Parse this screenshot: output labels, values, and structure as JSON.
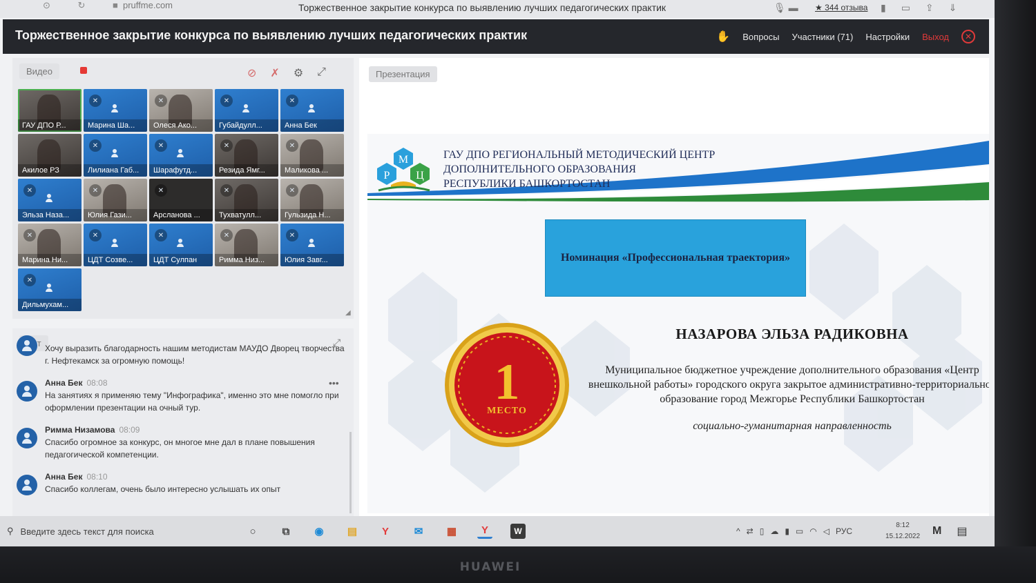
{
  "browser": {
    "url": "pruffme.com",
    "tab_title": "Торжественное закрытие конкурса по выявлению лучших педагогических практик",
    "reviews": "★ 344 отзыва"
  },
  "conference": {
    "title": "Торжественное закрытие конкурса по выявлению лучших педагогических практик",
    "nav": {
      "questions": "Вопросы",
      "participants": "Участники (71)",
      "settings": "Настройки",
      "exit": "Выход"
    }
  },
  "video": {
    "label": "Видео",
    "tiles": [
      {
        "name": "ГАУ ДПО Р...",
        "style": "cam",
        "mic_off": false
      },
      {
        "name": "Марина Ша...",
        "style": "blue",
        "mic_off": true
      },
      {
        "name": "Олеся Ако...",
        "style": "cam2",
        "mic_off": true
      },
      {
        "name": "Губайдулл...",
        "style": "blue",
        "mic_off": true
      },
      {
        "name": "Анна Бек",
        "style": "blue",
        "mic_off": true
      },
      {
        "name": "Акилое РЗ",
        "style": "cam",
        "mic_off": false
      },
      {
        "name": "Лилиана Габ...",
        "style": "blue",
        "mic_off": true
      },
      {
        "name": "Шарафутд...",
        "style": "blue",
        "mic_off": true
      },
      {
        "name": "Резида Ямг...",
        "style": "cam",
        "mic_off": true
      },
      {
        "name": "Маликова ...",
        "style": "cam2",
        "mic_off": true
      },
      {
        "name": "Эльза Наза...",
        "style": "blue",
        "mic_off": true
      },
      {
        "name": "Юлия Гази...",
        "style": "cam2",
        "mic_off": true
      },
      {
        "name": "Арсланова ...",
        "style": "dark",
        "mic_off": true
      },
      {
        "name": "Тухватулл...",
        "style": "cam",
        "mic_off": true
      },
      {
        "name": "Гульзида Н...",
        "style": "cam2",
        "mic_off": true
      },
      {
        "name": "Марина Ни...",
        "style": "cam2",
        "mic_off": true
      },
      {
        "name": "ЦДТ Созве...",
        "style": "blue",
        "mic_off": true
      },
      {
        "name": "ЦДТ Сулпан",
        "style": "blue",
        "mic_off": true
      },
      {
        "name": "Римма Низ...",
        "style": "cam2",
        "mic_off": true
      },
      {
        "name": "Юлия Завг...",
        "style": "blue",
        "mic_off": true
      },
      {
        "name": "Дильмухам...",
        "style": "blue",
        "mic_off": true
      }
    ]
  },
  "chat": {
    "label": "Чат",
    "messages": [
      {
        "author": "",
        "time": "",
        "text": "Хочу выразить благодарность нашим методистам МАУДО Дворец творчества г. Нефтекамск за огромную помощь!"
      },
      {
        "author": "Анна Бек",
        "time": "08:08",
        "text": "На занятиях я применяю тему \"Инфографика\", именно это мне помогло при оформлении презентации на очный тур."
      },
      {
        "author": "Римма Низамова",
        "time": "08:09",
        "text": "Спасибо огромное за конкурс, он многое мне дал в плане повышения педагогической компетенции."
      },
      {
        "author": "Анна Бек",
        "time": "08:10",
        "text": "Спасибо коллегам, очень было интересно услышать их опыт"
      }
    ]
  },
  "presentation": {
    "label": "Презентация",
    "org_lines": [
      "ГАУ ДПО РЕГИОНАЛЬНЫЙ МЕТОДИЧЕСКИЙ ЦЕНТР",
      "ДОПОЛНИТЕЛЬНОГО ОБРАЗОВАНИЯ",
      "РЕСПУБЛИКИ БАШКОРТОСТАН"
    ],
    "logo_letters": [
      "М",
      "Р",
      "Ц"
    ],
    "nomination": "Номинация «Профессиональная траектория»",
    "winner": "НАЗАРОВА ЭЛЬЗА РАДИКОВНА",
    "description": "Муниципальное бюджетное учреждение дополнительного образования «Центр внешкольной работы» городского округа закрытое административно-территориальное образование город Межгорье Республики Башкортостан",
    "direction": "социально-гуманитарная направленность",
    "medal_number": "1",
    "medal_text": "МЕСТО"
  },
  "taskbar": {
    "search_placeholder": "Введите здесь текст для поиска",
    "lang": "РУС",
    "time": "8:12",
    "date": "15.12.2022"
  },
  "device_brand": "HUAWEI",
  "colors": {
    "accent_blue": "#29a2dc",
    "tile_blue": "#2f7fcf",
    "exit_red": "#e03a3a",
    "medal_red": "#c8141b",
    "medal_gold": "#e9b321"
  }
}
